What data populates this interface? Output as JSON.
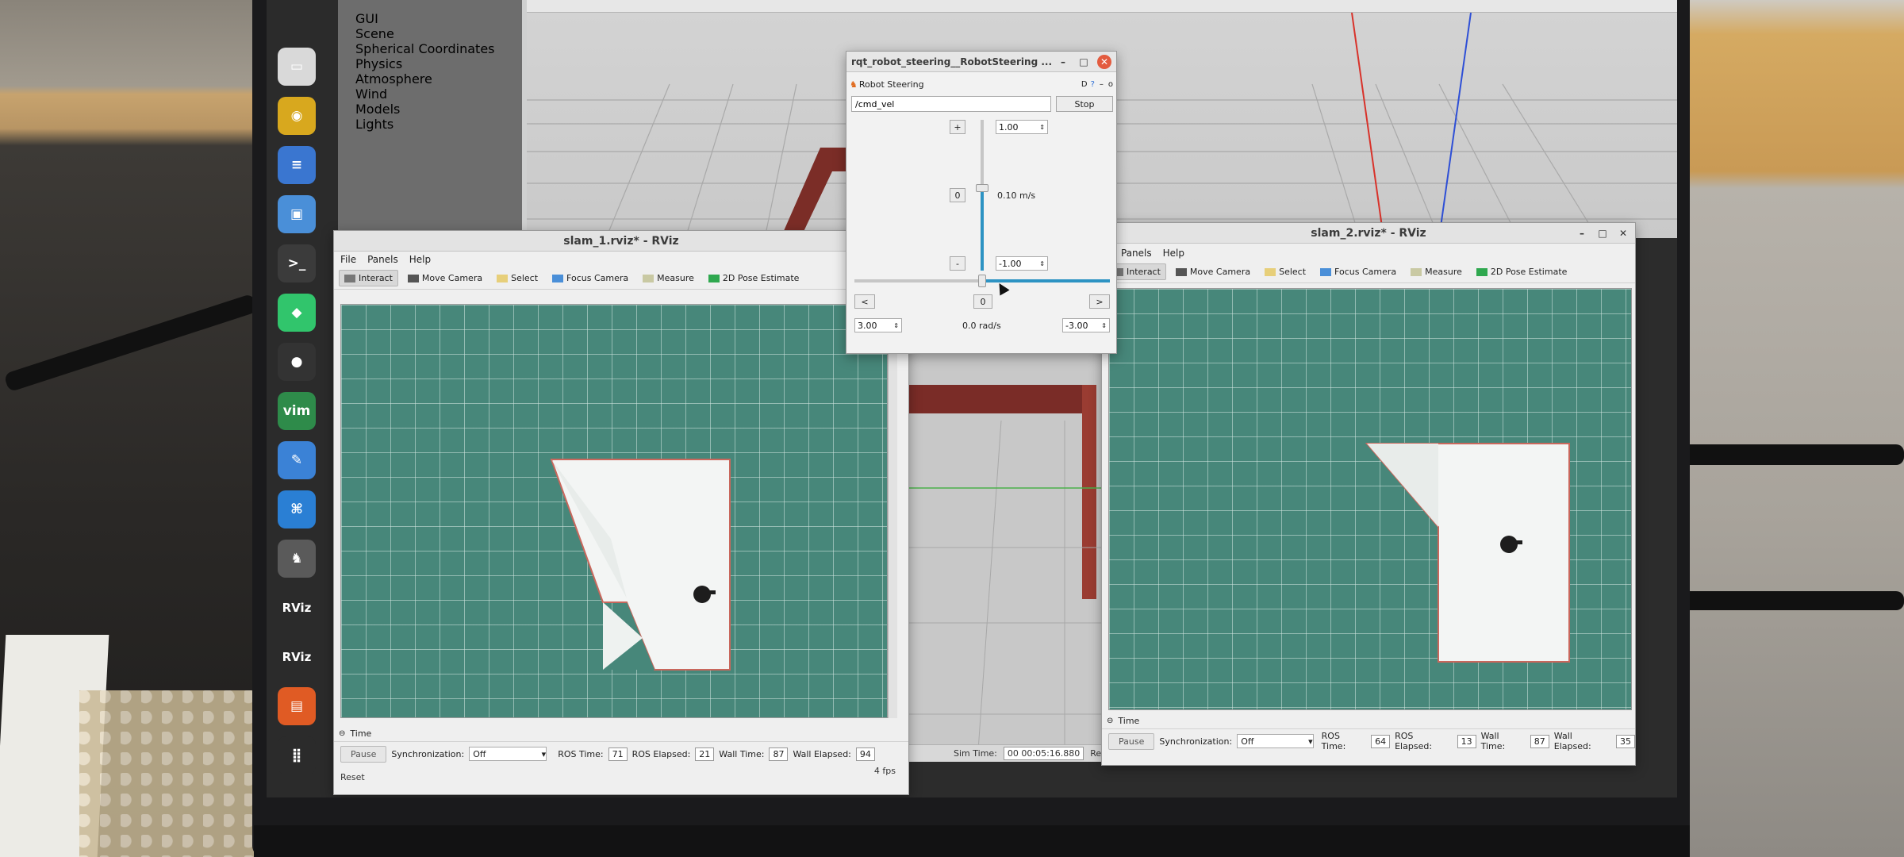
{
  "dock": {
    "items": [
      {
        "name": "files-icon",
        "glyph": "▭"
      },
      {
        "name": "rhythmbox-icon",
        "glyph": "◉"
      },
      {
        "name": "writer-icon",
        "glyph": "≡"
      },
      {
        "name": "software-icon",
        "glyph": "▣"
      },
      {
        "name": "terminal-icon",
        "glyph": ">_"
      },
      {
        "name": "3d-cube-icon",
        "glyph": "◆"
      },
      {
        "name": "screen-recorder-icon",
        "glyph": "●"
      },
      {
        "name": "vim-icon",
        "glyph": "vim"
      },
      {
        "name": "text-editor-icon",
        "glyph": "✎"
      },
      {
        "name": "vscode-icon",
        "glyph": "⌘"
      },
      {
        "name": "robot-steering-icon",
        "glyph": "♞"
      },
      {
        "name": "rviz-icon-1",
        "glyph": "RViz"
      },
      {
        "name": "rviz-icon-2",
        "glyph": "RViz"
      },
      {
        "name": "layers-icon",
        "glyph": "▤"
      },
      {
        "name": "app-grid-icon",
        "glyph": "⣿"
      }
    ]
  },
  "gazebo": {
    "tree": [
      "GUI",
      "Scene",
      "Spherical Coordinates",
      "Physics",
      "Atmosphere",
      "Wind",
      "Models",
      "Lights"
    ],
    "sim_time_label": "Sim Time:",
    "sim_time_value": "00 00:05:16.880",
    "extra": "Re"
  },
  "rviz1": {
    "title": "slam_1.rviz* - RViz",
    "menu": [
      "File",
      "Panels",
      "Help"
    ],
    "tools": [
      "Interact",
      "Move Camera",
      "Select",
      "Focus Camera",
      "Measure",
      "2D Pose Estimate"
    ],
    "time": {
      "header": "Time",
      "pause": "Pause",
      "sync_label": "Synchronization:",
      "sync_value": "Off",
      "ros_time_label": "ROS Time:",
      "ros_time": "71",
      "ros_elapsed_label": "ROS Elapsed:",
      "ros_elapsed": "21",
      "wall_time_label": "Wall Time:",
      "wall_time": "87",
      "wall_elapsed_label": "Wall Elapsed:",
      "wall_elapsed": "94",
      "reset": "Reset",
      "fps": "4 fps"
    }
  },
  "rviz2": {
    "title": "slam_2.rviz* - RViz",
    "menu": [
      "Panels",
      "Help"
    ],
    "tools": [
      "Interact",
      "Move Camera",
      "Select",
      "Focus Camera",
      "Measure",
      "2D Pose Estimate"
    ],
    "time": {
      "header": "Time",
      "pause": "Pause",
      "sync_label": "Synchronization:",
      "sync_value": "Off",
      "ros_time_label": "ROS Time:",
      "ros_time": "64",
      "ros_elapsed_label": "ROS Elapsed:",
      "ros_elapsed": "13",
      "wall_time_label": "Wall Time:",
      "wall_time": "87",
      "wall_elapsed_label": "Wall Elapsed:",
      "wall_elapsed": "35"
    }
  },
  "steering": {
    "title": "rqt_robot_steering__RobotSteering ...",
    "plugin_title": "Robot Steering",
    "plugin_btns": "D",
    "topic": "/cmd_vel",
    "stop": "Stop",
    "plus": "+",
    "minus": "-",
    "zero": "0",
    "left": "<",
    "right": ">",
    "max_linear": "1.00",
    "min_linear": "-1.00",
    "linear_value": "0.10 m/s",
    "linear_fraction": 0.55,
    "max_angular": "3.00",
    "min_angular": "-3.00",
    "angular_value": "0.0 rad/s",
    "angular_fraction": 0.5
  },
  "colors": {
    "grid": "#47877a",
    "accent": "#2d93c3",
    "close": "#e35b3f"
  }
}
